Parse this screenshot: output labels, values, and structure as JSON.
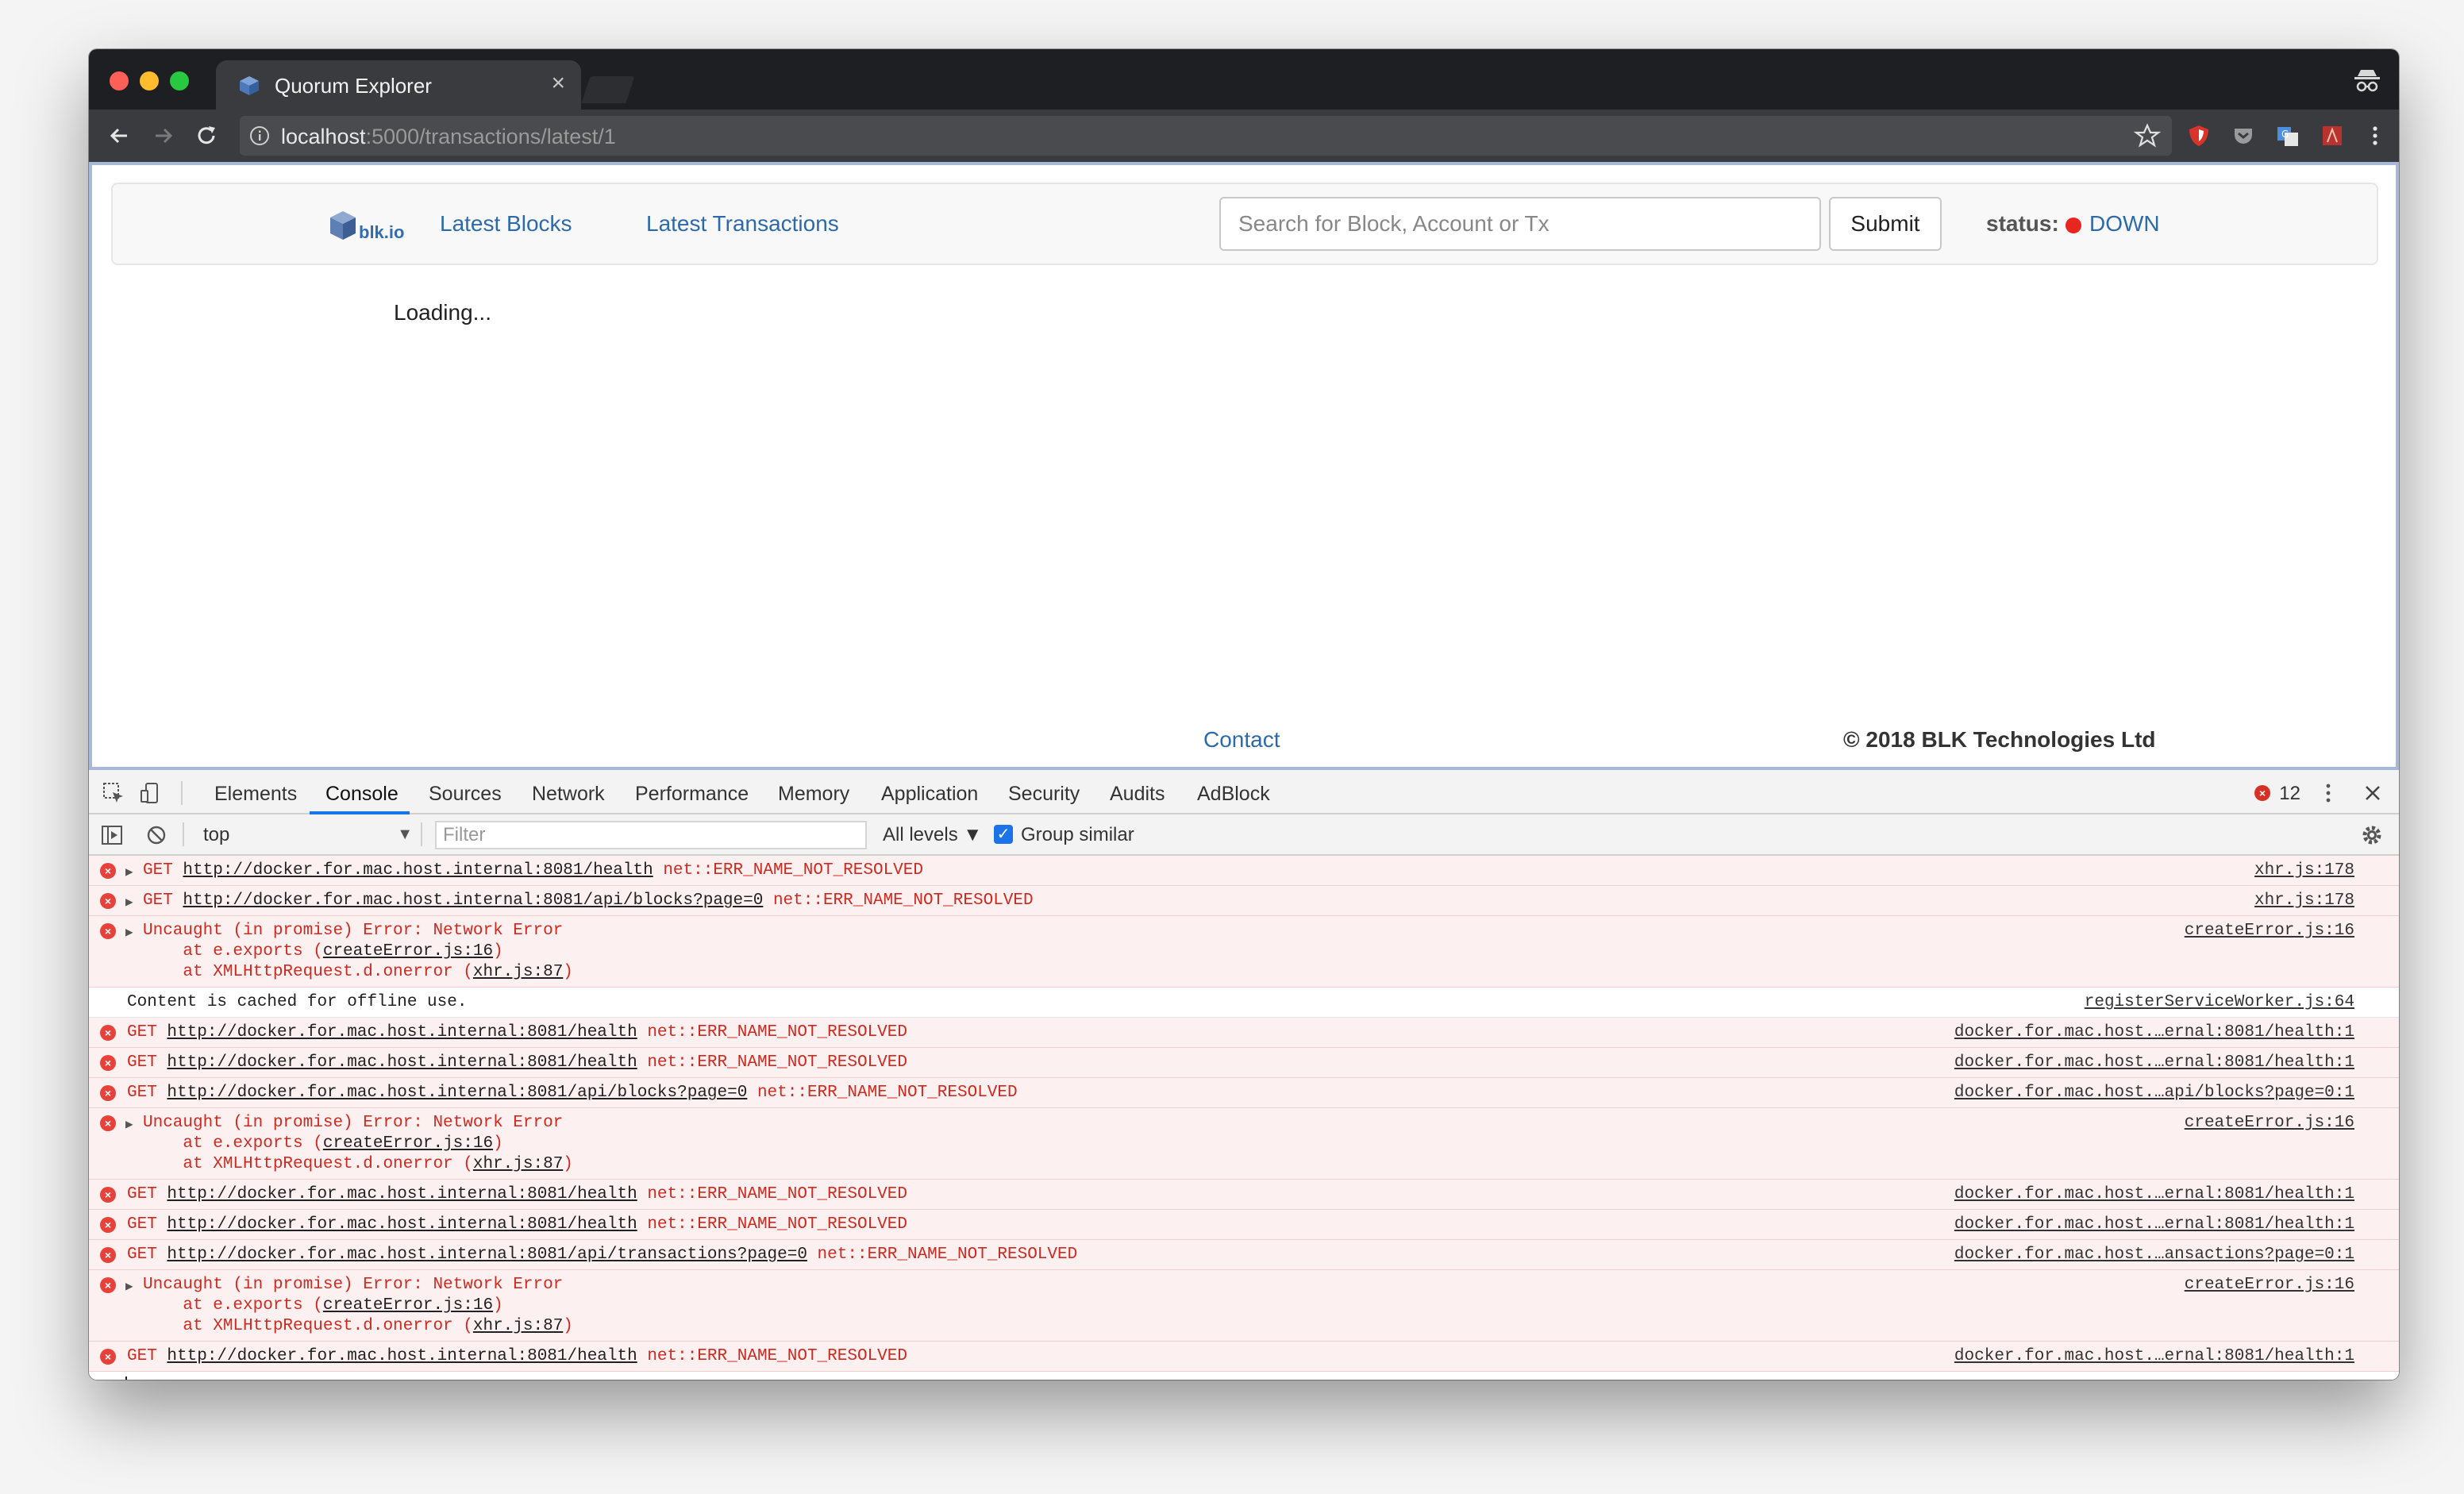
{
  "browser": {
    "tab_title": "Quorum Explorer",
    "url_host": "localhost",
    "url_path": ":5000/transactions/latest/1"
  },
  "app": {
    "logo_text": "blk.io",
    "nav": [
      {
        "label": "Latest Blocks"
      },
      {
        "label": "Latest Transactions"
      }
    ],
    "search_placeholder": "Search for Block, Account or Tx",
    "submit_label": "Submit",
    "status_label": "status:",
    "status_value": "DOWN",
    "status_color": "#e8261f",
    "loading_text": "Loading...",
    "footer_contact": "Contact",
    "footer_copyright": "© 2018 BLK Technologies Ltd"
  },
  "devtools": {
    "tabs": [
      "Elements",
      "Console",
      "Sources",
      "Network",
      "Performance",
      "Memory",
      "Application",
      "Security",
      "Audits",
      "AdBlock"
    ],
    "active_tab": "Console",
    "error_count": "12",
    "context": "top",
    "filter_placeholder": "Filter",
    "levels_label": "All levels ▼",
    "group_similar_label": "Group similar",
    "messages": [
      {
        "type": "error",
        "expandable": true,
        "lines": [
          "GET http://docker.for.mac.host.internal:8081/health net::ERR_NAME_NOT_RESOLVED"
        ],
        "source": "xhr.js:178"
      },
      {
        "type": "error",
        "expandable": true,
        "lines": [
          "GET http://docker.for.mac.host.internal:8081/api/blocks?page=0 net::ERR_NAME_NOT_RESOLVED"
        ],
        "source": "xhr.js:178"
      },
      {
        "type": "error",
        "expandable": true,
        "lines": [
          "Uncaught (in promise) Error: Network Error",
          "    at e.exports (createError.js:16)",
          "    at XMLHttpRequest.d.onerror (xhr.js:87)"
        ],
        "source": "createError.js:16"
      },
      {
        "type": "info",
        "expandable": false,
        "lines": [
          "Content is cached for offline use."
        ],
        "source": "registerServiceWorker.js:64"
      },
      {
        "type": "error",
        "expandable": false,
        "lines": [
          "GET http://docker.for.mac.host.internal:8081/health net::ERR_NAME_NOT_RESOLVED"
        ],
        "source": "docker.for.mac.host.…ernal:8081/health:1"
      },
      {
        "type": "error",
        "expandable": false,
        "lines": [
          "GET http://docker.for.mac.host.internal:8081/health net::ERR_NAME_NOT_RESOLVED"
        ],
        "source": "docker.for.mac.host.…ernal:8081/health:1"
      },
      {
        "type": "error",
        "expandable": false,
        "lines": [
          "GET http://docker.for.mac.host.internal:8081/api/blocks?page=0 net::ERR_NAME_NOT_RESOLVED"
        ],
        "source": "docker.for.mac.host.…api/blocks?page=0:1"
      },
      {
        "type": "error",
        "expandable": true,
        "lines": [
          "Uncaught (in promise) Error: Network Error",
          "    at e.exports (createError.js:16)",
          "    at XMLHttpRequest.d.onerror (xhr.js:87)"
        ],
        "source": "createError.js:16"
      },
      {
        "type": "error",
        "expandable": false,
        "lines": [
          "GET http://docker.for.mac.host.internal:8081/health net::ERR_NAME_NOT_RESOLVED"
        ],
        "source": "docker.for.mac.host.…ernal:8081/health:1"
      },
      {
        "type": "error",
        "expandable": false,
        "lines": [
          "GET http://docker.for.mac.host.internal:8081/health net::ERR_NAME_NOT_RESOLVED"
        ],
        "source": "docker.for.mac.host.…ernal:8081/health:1"
      },
      {
        "type": "error",
        "expandable": false,
        "lines": [
          "GET http://docker.for.mac.host.internal:8081/api/transactions?page=0 net::ERR_NAME_NOT_RESOLVED"
        ],
        "source": "docker.for.mac.host.…ansactions?page=0:1"
      },
      {
        "type": "error",
        "expandable": true,
        "lines": [
          "Uncaught (in promise) Error: Network Error",
          "    at e.exports (createError.js:16)",
          "    at XMLHttpRequest.d.onerror (xhr.js:87)"
        ],
        "source": "createError.js:16"
      },
      {
        "type": "error",
        "expandable": false,
        "lines": [
          "GET http://docker.for.mac.host.internal:8081/health net::ERR_NAME_NOT_RESOLVED"
        ],
        "source": "docker.for.mac.host.…ernal:8081/health:1"
      }
    ],
    "prompt_symbol": "›"
  }
}
